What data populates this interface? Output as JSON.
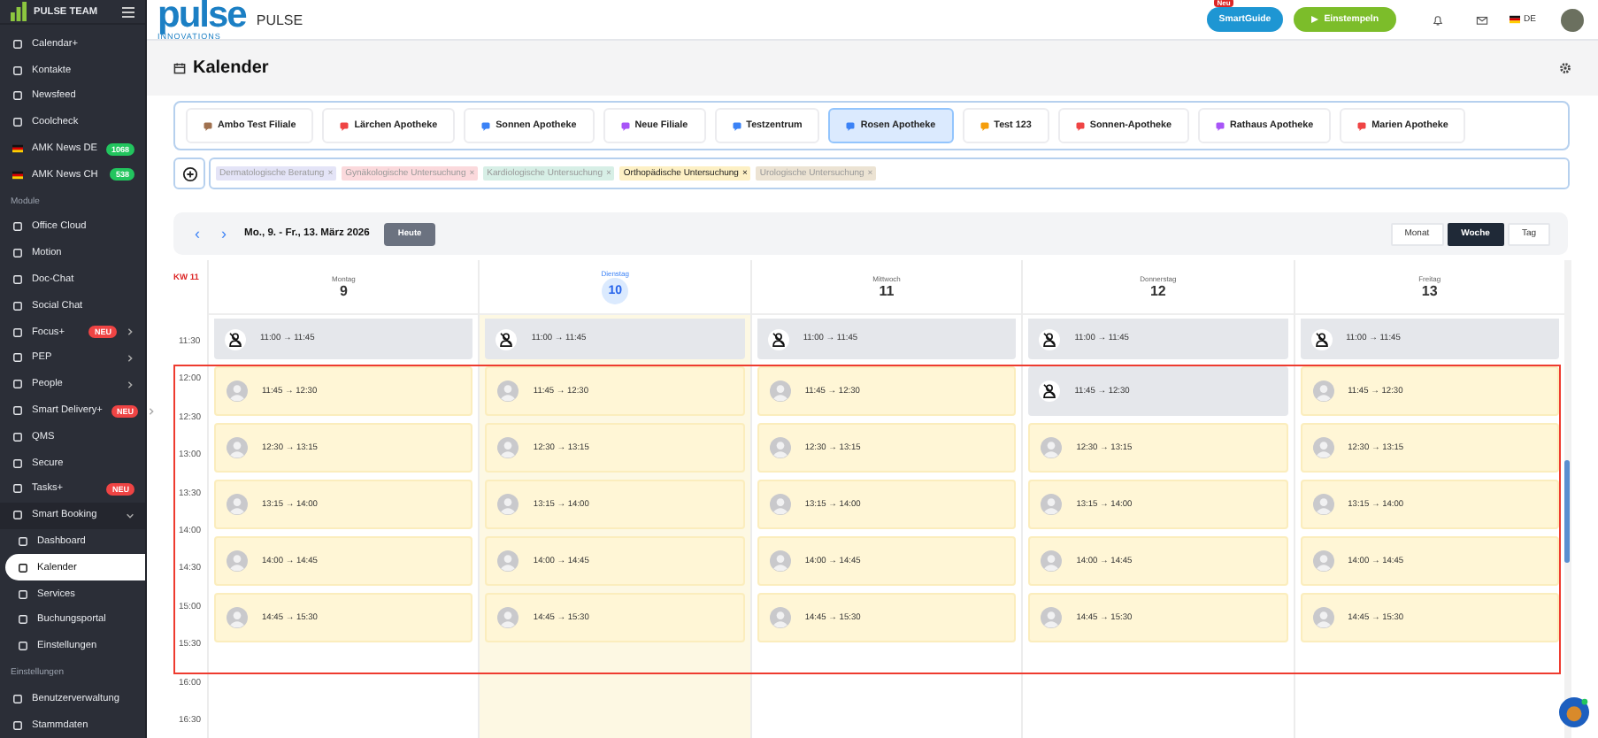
{
  "sidebar": {
    "brand": "PULSE TEAM",
    "items": [
      {
        "kind": "item",
        "label": "Calendar+",
        "selected": false
      },
      {
        "kind": "item",
        "label": "Kontakte",
        "selected": false
      },
      {
        "kind": "item",
        "label": "Newsfeed",
        "selected": false
      },
      {
        "kind": "item",
        "label": "Coolcheck",
        "selected": false
      },
      {
        "kind": "news",
        "label": "AMK News DE",
        "badge": "1068",
        "color": "#22c55e",
        "selected": false
      },
      {
        "kind": "news",
        "label": "AMK News CH",
        "badge": "538",
        "color": "#22c55e",
        "selected": false
      },
      {
        "kind": "section",
        "label": "Module"
      },
      {
        "kind": "item",
        "label": "Office Cloud",
        "selected": false
      },
      {
        "kind": "item",
        "label": "Motion",
        "selected": false
      },
      {
        "kind": "item",
        "label": "Doc-Chat",
        "selected": false
      },
      {
        "kind": "item",
        "label": "Social Chat",
        "selected": false
      },
      {
        "kind": "group",
        "label": "Focus+",
        "badge": "NEU",
        "color": "#ef4444",
        "expanded": false,
        "selected": false
      },
      {
        "kind": "group",
        "label": "PEP",
        "expanded": false,
        "selected": false
      },
      {
        "kind": "group",
        "label": "People",
        "expanded": false,
        "selected": false
      },
      {
        "kind": "group",
        "label": "Smart Delivery+",
        "badge": "NEU",
        "color": "#ef4444",
        "expanded": false,
        "selected": false
      },
      {
        "kind": "item",
        "label": "QMS",
        "selected": false
      },
      {
        "kind": "item",
        "label": "Secure",
        "selected": false
      },
      {
        "kind": "item",
        "label": "Tasks+",
        "badge": "NEU",
        "color": "#ef4444",
        "selected": false
      },
      {
        "kind": "group",
        "label": "Smart Booking",
        "expanded": true,
        "selected": false,
        "children": [
          {
            "label": "Dashboard",
            "selected": false
          },
          {
            "label": "Kalender",
            "selected": true
          },
          {
            "label": "Services",
            "selected": false
          },
          {
            "label": "Buchungsportal",
            "selected": false
          },
          {
            "label": "Einstellungen",
            "selected": false
          }
        ]
      },
      {
        "kind": "section",
        "label": "Einstellungen"
      },
      {
        "kind": "item",
        "label": "Benutzerverwaltung",
        "selected": false
      },
      {
        "kind": "item",
        "label": "Stammdaten",
        "selected": false
      }
    ]
  },
  "topbar": {
    "logo": "pulse",
    "tagline": "INNOVATIONS",
    "app_name": "PULSE",
    "smartguide": {
      "label": "SmartGuide",
      "badge": "Neu"
    },
    "clock_in": "Einstempeln",
    "language": "DE"
  },
  "page": {
    "title": "Kalender"
  },
  "branches": [
    {
      "label": "Ambo Test Filiale",
      "color": "#a0714f",
      "selected": false
    },
    {
      "label": "Lärchen Apotheke",
      "color": "#ef4444",
      "selected": false
    },
    {
      "label": "Sonnen Apotheke",
      "color": "#3b82f6",
      "selected": false
    },
    {
      "label": "Neue Filiale",
      "color": "#a855f7",
      "selected": false
    },
    {
      "label": "Testzentrum",
      "color": "#3b82f6",
      "selected": false
    },
    {
      "label": "Rosen Apotheke",
      "color": "#3b82f6",
      "selected": true
    },
    {
      "label": "Test 123",
      "color": "#f59e0b",
      "selected": false
    },
    {
      "label": "Sonnen-Apotheke",
      "color": "#ef4444",
      "selected": false
    },
    {
      "label": "Rathaus Apotheke",
      "color": "#a855f7",
      "selected": false
    },
    {
      "label": "Marien Apotheke",
      "color": "#ef4444",
      "selected": false
    }
  ],
  "filters": [
    {
      "label": "Dermatologische Beratung",
      "remove": "×",
      "color": "#e4e4f7",
      "selected": false
    },
    {
      "label": "Gynäkologische Untersuchung",
      "remove": "×",
      "color": "#fbd9dc",
      "selected": false
    },
    {
      "label": "Kardiologische Untersuchung",
      "remove": "×",
      "color": "#d7efe6",
      "selected": false
    },
    {
      "label": "Orthopädische Untersuchung",
      "remove": "×",
      "color": "#fdf0c4",
      "selected": true
    },
    {
      "label": "Urologische Untersuchung",
      "remove": "×",
      "color": "#ece3d3",
      "selected": false
    }
  ],
  "calendar": {
    "prev": "‹",
    "next": "›",
    "range": "Mo., 9. - Fr., 13. März 2026",
    "today_button": "Heute",
    "views": [
      {
        "label": "Monat",
        "selected": false
      },
      {
        "label": "Woche",
        "selected": true
      },
      {
        "label": "Tag",
        "selected": false
      }
    ],
    "week": "KW 11",
    "times": [
      "11:30",
      "12:00",
      "12:30",
      "13:00",
      "13:30",
      "14:00",
      "14:30",
      "15:00",
      "15:30",
      "16:00",
      "16:30"
    ],
    "days": [
      {
        "name": "Montag",
        "date": "9",
        "today": false,
        "events": [
          {
            "kind": "blocked",
            "time": "11:00 → 11:45"
          },
          {
            "kind": "booked",
            "time": "11:45 → 12:30"
          },
          {
            "kind": "booked",
            "time": "12:30 → 13:15"
          },
          {
            "kind": "booked",
            "time": "13:15 → 14:00"
          },
          {
            "kind": "booked",
            "time": "14:00 → 14:45"
          },
          {
            "kind": "booked",
            "time": "14:45 → 15:30"
          }
        ]
      },
      {
        "name": "Dienstag",
        "date": "10",
        "today": true,
        "events": [
          {
            "kind": "blocked",
            "time": "11:00 → 11:45"
          },
          {
            "kind": "booked",
            "time": "11:45 → 12:30"
          },
          {
            "kind": "booked",
            "time": "12:30 → 13:15"
          },
          {
            "kind": "booked",
            "time": "13:15 → 14:00"
          },
          {
            "kind": "booked",
            "time": "14:00 → 14:45"
          },
          {
            "kind": "booked",
            "time": "14:45 → 15:30"
          }
        ]
      },
      {
        "name": "Mittwoch",
        "date": "11",
        "today": false,
        "events": [
          {
            "kind": "blocked",
            "time": "11:00 → 11:45"
          },
          {
            "kind": "booked",
            "time": "11:45 → 12:30"
          },
          {
            "kind": "booked",
            "time": "12:30 → 13:15"
          },
          {
            "kind": "booked",
            "time": "13:15 → 14:00"
          },
          {
            "kind": "booked",
            "time": "14:00 → 14:45"
          },
          {
            "kind": "booked",
            "time": "14:45 → 15:30"
          }
        ]
      },
      {
        "name": "Donnerstag",
        "date": "12",
        "today": false,
        "events": [
          {
            "kind": "blocked",
            "time": "11:00 → 11:45"
          },
          {
            "kind": "blocked",
            "time": "11:45 → 12:30"
          },
          {
            "kind": "booked",
            "time": "12:30 → 13:15"
          },
          {
            "kind": "booked",
            "time": "13:15 → 14:00"
          },
          {
            "kind": "booked",
            "time": "14:00 → 14:45"
          },
          {
            "kind": "booked",
            "time": "14:45 → 15:30"
          }
        ]
      },
      {
        "name": "Freitag",
        "date": "13",
        "today": false,
        "events": [
          {
            "kind": "blocked",
            "time": "11:00 → 11:45"
          },
          {
            "kind": "booked",
            "time": "11:45 → 12:30"
          },
          {
            "kind": "booked",
            "time": "12:30 → 13:15"
          },
          {
            "kind": "booked",
            "time": "13:15 → 14:00"
          },
          {
            "kind": "booked",
            "time": "14:00 → 14:45"
          },
          {
            "kind": "booked",
            "time": "14:45 → 15:30"
          }
        ]
      }
    ]
  }
}
